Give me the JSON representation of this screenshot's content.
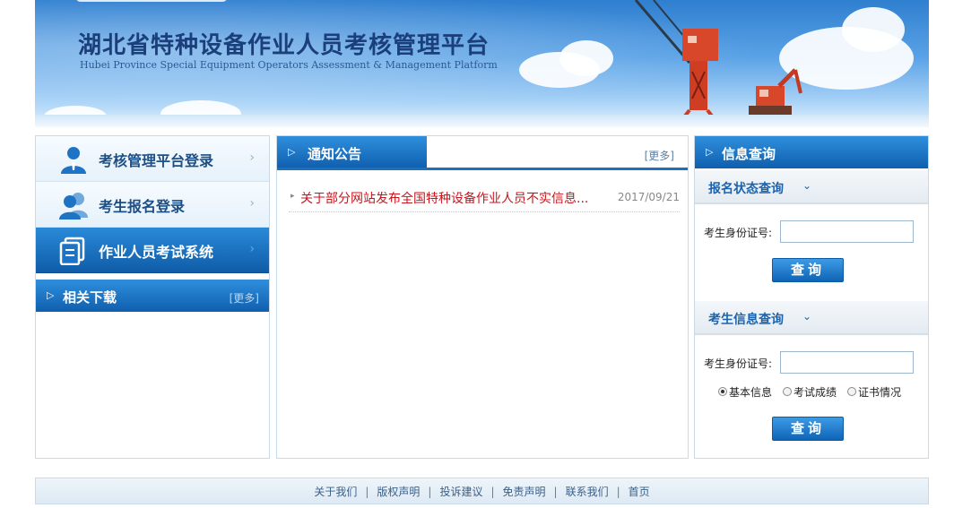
{
  "banner": {
    "title_zh": "湖北省特种设备作业人员考核管理平台",
    "title_en": "Hubei Province Special Equipment Operators Assessment & Management Platform"
  },
  "nav": {
    "items": [
      {
        "label": "考核管理平台登录",
        "icon": "admin-user-icon",
        "active": false
      },
      {
        "label": "考生报名登录",
        "icon": "users-icon",
        "active": false
      },
      {
        "label": "作业人员考试系统",
        "icon": "exam-document-icon",
        "active": true
      }
    ],
    "chevron": "›"
  },
  "downloads": {
    "title": "相关下载",
    "more": "[更多]"
  },
  "notice": {
    "title": "通知公告",
    "more": "[更多]",
    "items": [
      {
        "title": "关于部分网站发布全国特种设备作业人员不实信息...",
        "date": "2017/09/21"
      }
    ]
  },
  "info_query": {
    "title": "信息查询",
    "status_section": {
      "title": "报名状态查询",
      "label": "考生身份证号:",
      "value": "",
      "button": "查询"
    },
    "info_section": {
      "title": "考生信息查询",
      "label": "考生身份证号:",
      "value": "",
      "options": [
        "基本信息",
        "考试成绩",
        "证书情况"
      ],
      "selected": "基本信息",
      "button": "查询"
    }
  },
  "footer": {
    "links": [
      "关于我们",
      "版权声明",
      "投诉建议",
      "免责声明",
      "联系我们",
      "首页"
    ]
  },
  "colors": {
    "primary": "#1565b3",
    "header_gradient_top": "#2f8fdd",
    "link_red": "#c8141c",
    "title_navy": "#1a3f7a"
  }
}
